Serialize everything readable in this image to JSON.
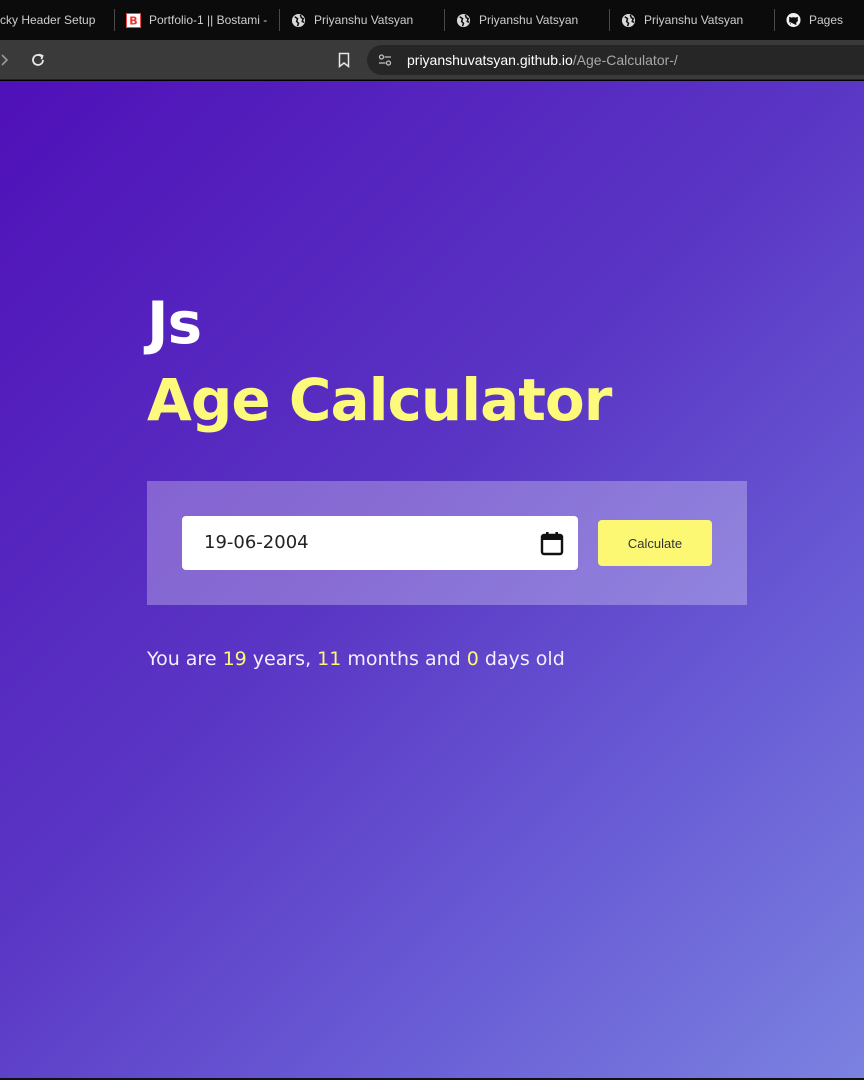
{
  "browser": {
    "tabs": [
      {
        "label": "cky Header Setup",
        "icon": "none"
      },
      {
        "label": "Portfolio-1 || Bostami -",
        "icon": "bostami-favicon"
      },
      {
        "label": "Priyanshu Vatsyan",
        "icon": "globe-icon"
      },
      {
        "label": "Priyanshu Vatsyan",
        "icon": "globe-icon"
      },
      {
        "label": "Priyanshu Vatsyan",
        "icon": "globe-icon"
      },
      {
        "label": "Pages",
        "icon": "github-icon"
      }
    ],
    "url_host": "priyanshuvatsyan.github.io",
    "url_path": "/Age-Calculator-/"
  },
  "page": {
    "heading_small": "Js",
    "heading_main": "Age Calculator",
    "date_value": "19-06-2004",
    "calculate_label": "Calculate",
    "result": {
      "prefix": "You are ",
      "years": "19",
      "years_text": " years, ",
      "months": "11",
      "months_text": " months and ",
      "days": "0",
      "days_text": " days old"
    }
  },
  "colors": {
    "accent_yellow": "#fdf874",
    "gradient_start": "#4f10b8",
    "gradient_end": "#7b82e0"
  }
}
